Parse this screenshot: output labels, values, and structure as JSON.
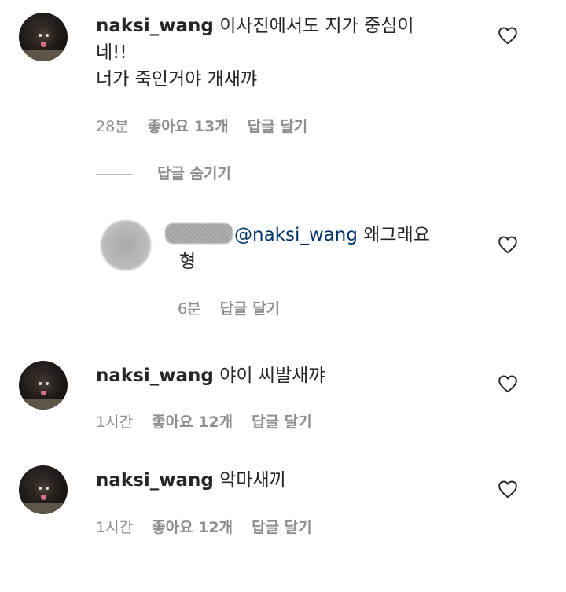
{
  "comments": [
    {
      "username": "naksi_wang",
      "text_line1": "이사진에서도 지가 중심이",
      "text_line2": "네!!",
      "text_line3": "너가 죽인거야 개새꺄",
      "time": "28분",
      "likes": "좋아요 13개",
      "reply": "답글 달기"
    },
    {
      "username": "naksi_wang",
      "text": "야이 씨발새꺄",
      "time": "1시간",
      "likes": "좋아요 12개",
      "reply": "답글 달기"
    },
    {
      "username": "naksi_wang",
      "text": "악마새끼",
      "time": "1시간",
      "likes": "좋아요 12개",
      "reply": "답글 달기"
    }
  ],
  "hide_replies_label": "답글 숨기기",
  "reply_item": {
    "mention": "@naksi_wang",
    "text_line1": "왜그래요",
    "text_line2": "형",
    "time": "6분",
    "reply": "답글 달기"
  },
  "icons": {
    "like": "heart-outline-icon"
  },
  "colors": {
    "text": "#262626",
    "meta": "#8e8e8e",
    "mention": "#00376b"
  }
}
